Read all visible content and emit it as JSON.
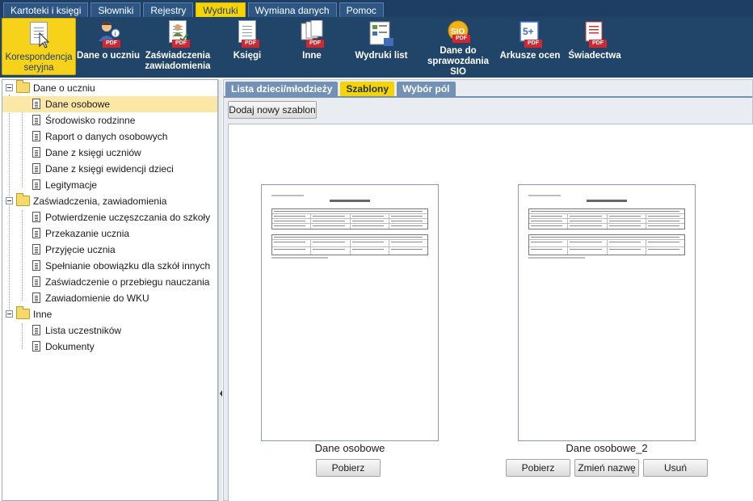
{
  "menu": [
    "Kartoteki i księgi",
    "Słowniki",
    "Rejestry",
    "Wydruki",
    "Wymiana danych",
    "Pomoc"
  ],
  "menu_active": "Wydruki",
  "toolbar": [
    {
      "label": "Korespondencja seryjna",
      "icon": "mail-merge-document-icon"
    },
    {
      "label": "Dane o uczniu",
      "icon": "student-pdf-icon"
    },
    {
      "label": "Zaświadczenia zawiadomienia",
      "icon": "certificate-pdf-icon"
    },
    {
      "label": "Księgi",
      "icon": "books-pdf-icon"
    },
    {
      "label": "Inne",
      "icon": "documents-pdf-icon"
    },
    {
      "label": "Wydruki list",
      "icon": "list-print-icon"
    },
    {
      "label": "Dane do sprawozdania SIO",
      "icon": "sio-pdf-icon"
    },
    {
      "label": "Arkusze ocen",
      "icon": "grades-sheet-icon"
    },
    {
      "label": "Świadectwa",
      "icon": "diploma-pdf-icon"
    }
  ],
  "tree": {
    "groups": [
      {
        "label": "Dane o uczniu",
        "items": [
          "Dane osobowe",
          "Środowisko rodzinne",
          "Raport o danych osobowych",
          "Dane z księgi uczniów",
          "Dane z księgi ewidencji dzieci",
          "Legitymacje"
        ]
      },
      {
        "label": "Zaświadczenia, zawiadomienia",
        "items": [
          "Potwierdzenie uczęszczania do szkoły",
          "Przekazanie ucznia",
          "Przyjęcie ucznia",
          "Spełnianie obowiązku dla szkół innych",
          "Zaświadczenie o przebiegu nauczania",
          "Zawiadomienie do WKU"
        ]
      },
      {
        "label": "Inne",
        "items": [
          "Lista uczestników",
          "Dokumenty"
        ]
      }
    ],
    "selected": "Dane osobowe"
  },
  "tabs": [
    "Lista dzieci/młodzieży",
    "Szablony",
    "Wybór pól"
  ],
  "tab_active": "Szablony",
  "add_button": "Dodaj nowy szablon",
  "templates": [
    {
      "name": "Dane osobowe",
      "buttons": [
        "Pobierz"
      ]
    },
    {
      "name": "Dane osobowe_2",
      "buttons": [
        "Pobierz",
        "Zmień nazwę",
        "Usuń"
      ]
    }
  ],
  "preview_title": "Dane osobowe",
  "colors": {
    "menu_bg": "#1f3e63",
    "accent": "#f5d400",
    "tab_bg": "#7391b5",
    "selected_row": "#fbe8a6",
    "pdf_badge": "#d4262c"
  }
}
